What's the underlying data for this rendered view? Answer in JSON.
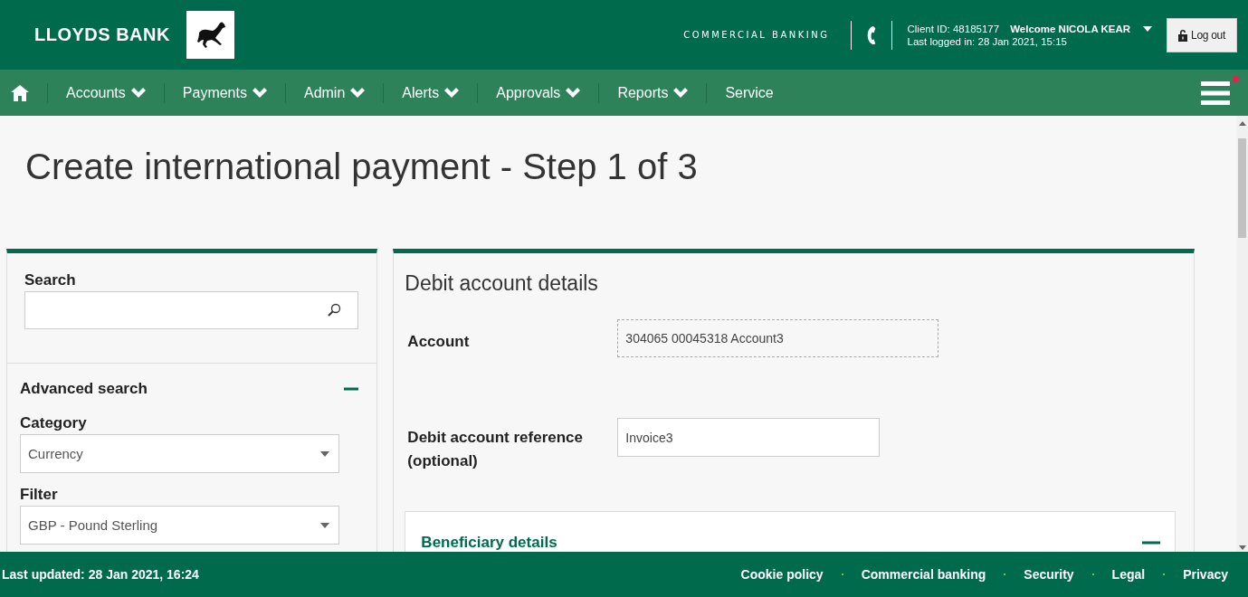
{
  "header": {
    "brand": "LLOYDS BANK",
    "division": "COMMERCIAL BANKING",
    "client_id": "Client ID: 48185177",
    "welcome": "Welcome NICOLA KEAR",
    "last_logged": "Last logged in: 28 Jan 2021, 15:15",
    "logout": "Log out"
  },
  "nav": {
    "items": [
      {
        "label": "Accounts",
        "dropdown": true
      },
      {
        "label": "Payments",
        "dropdown": true
      },
      {
        "label": "Admin",
        "dropdown": true
      },
      {
        "label": "Alerts",
        "dropdown": true
      },
      {
        "label": "Approvals",
        "dropdown": true
      },
      {
        "label": "Reports",
        "dropdown": true
      },
      {
        "label": "Service",
        "dropdown": false
      }
    ],
    "notification": true
  },
  "page": {
    "title": "Create international payment - Step 1 of 3"
  },
  "sidebar": {
    "search_label": "Search",
    "advanced_title": "Advanced search",
    "advanced_expanded": true,
    "filters": [
      {
        "label": "Category",
        "value": "Currency"
      },
      {
        "label": "Filter",
        "value": "GBP - Pound Sterling"
      }
    ]
  },
  "debit": {
    "title": "Debit account details",
    "account_label": "Account",
    "account_value": "304065 00045318 Account3",
    "reference_label": "Debit account reference (optional)",
    "reference_value": "Invoice3"
  },
  "beneficiary": {
    "title": "Beneficiary details",
    "expanded": true
  },
  "footer": {
    "updated": "Last updated: 28 Jan 2021, 16:24",
    "links": [
      "Cookie policy",
      "Commercial banking",
      "Security",
      "Legal",
      "Privacy"
    ]
  }
}
